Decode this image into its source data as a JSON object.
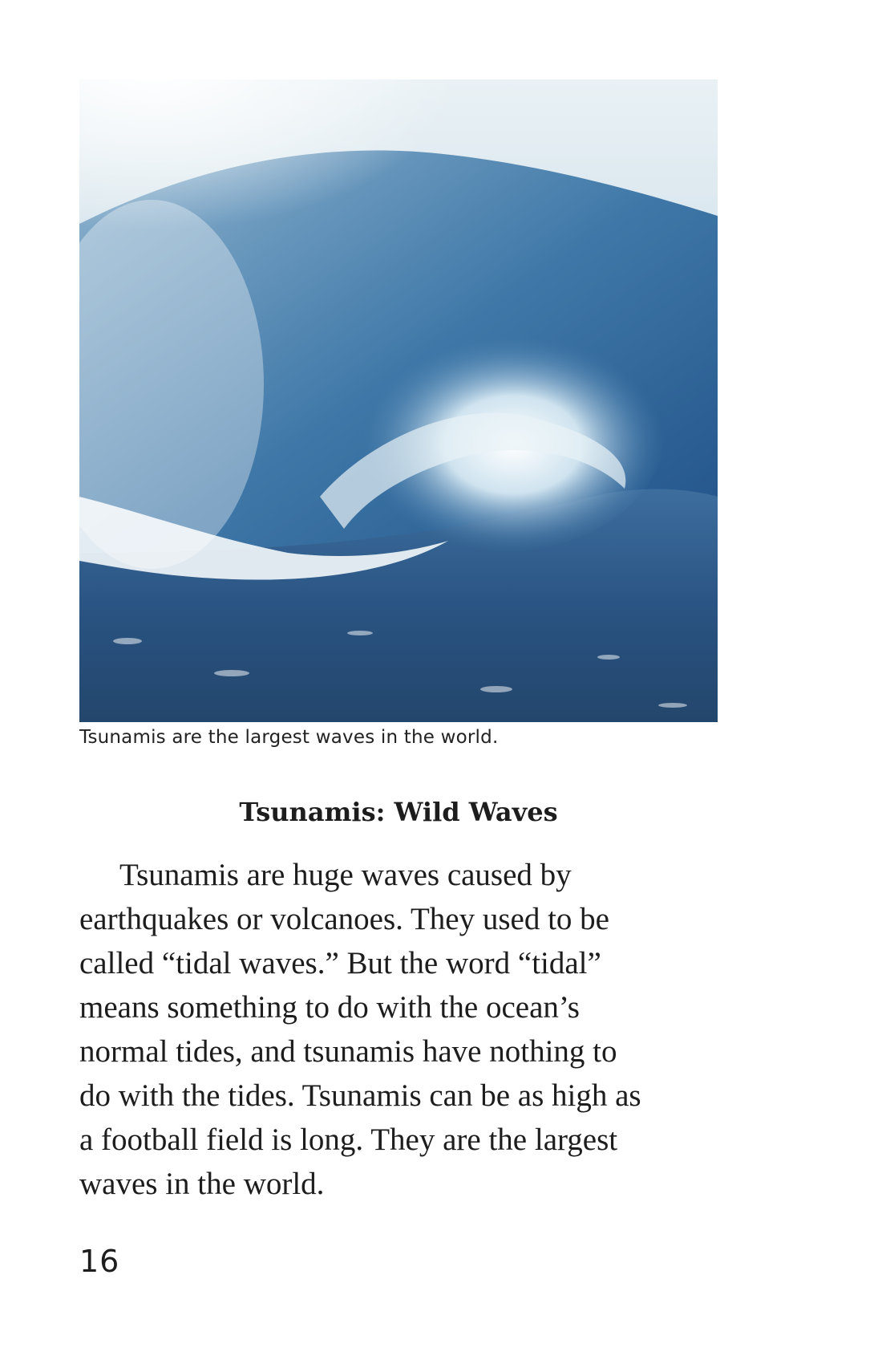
{
  "photo": {
    "caption": "Tsunamis are the largest waves in the world."
  },
  "heading": "Tsunamis: Wild Waves",
  "paragraph_lines": [
    "Tsunamis are huge waves caused by",
    "earthquakes or volcanoes. They used to be",
    "called “tidal waves.” But the word “tidal”",
    "means something to do with the ocean’s",
    "normal tides, and tsunamis have nothing to",
    "do with the tides. Tsunamis can be as high as",
    "a football field is long. They are the largest",
    "waves in the world."
  ],
  "page_number": "16"
}
